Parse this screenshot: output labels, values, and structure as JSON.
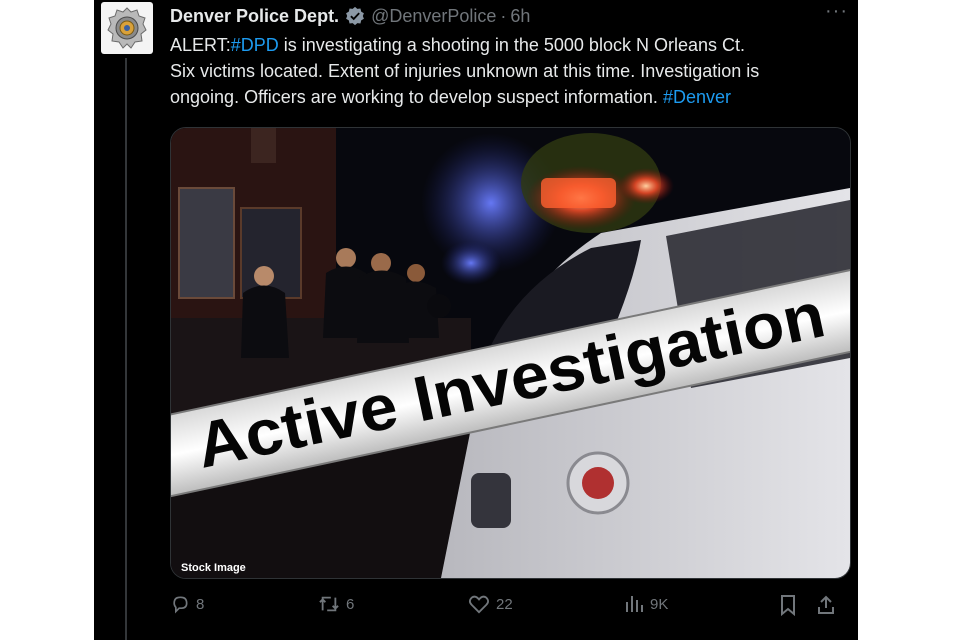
{
  "tweet": {
    "author_name": "Denver Police Dept.",
    "handle": "@DenverPolice",
    "separator": "·",
    "time": "6h",
    "more": "···",
    "text": {
      "alert_prefix": "ALERT:",
      "hashtag_dpd": "#DPD",
      "line1_rest": " is investigating a shooting in the 5000 block N Orleans Ct.",
      "line2": "Six victims located. Extent of injuries unknown at this time. Investigation is",
      "line3": "ongoing. Officers are working to develop suspect information. ",
      "hashtag_denver": "#Denver"
    },
    "media": {
      "banner_text": "Active Investigation",
      "caption": "Stock Image"
    },
    "stats": {
      "replies": "8",
      "reposts": "6",
      "likes": "22",
      "views": "9K"
    },
    "colors": {
      "background": "#000000",
      "text": "#e7e9ea",
      "muted": "#71767b",
      "link": "#1d9bf0",
      "verified": "#1d9bf0"
    },
    "icons": {
      "reply": "reply-icon",
      "repost": "repost-icon",
      "like": "heart-icon",
      "views": "views-icon",
      "bookmark": "bookmark-icon",
      "share": "share-icon",
      "verified": "verified-badge-icon",
      "more": "more-icon"
    }
  }
}
